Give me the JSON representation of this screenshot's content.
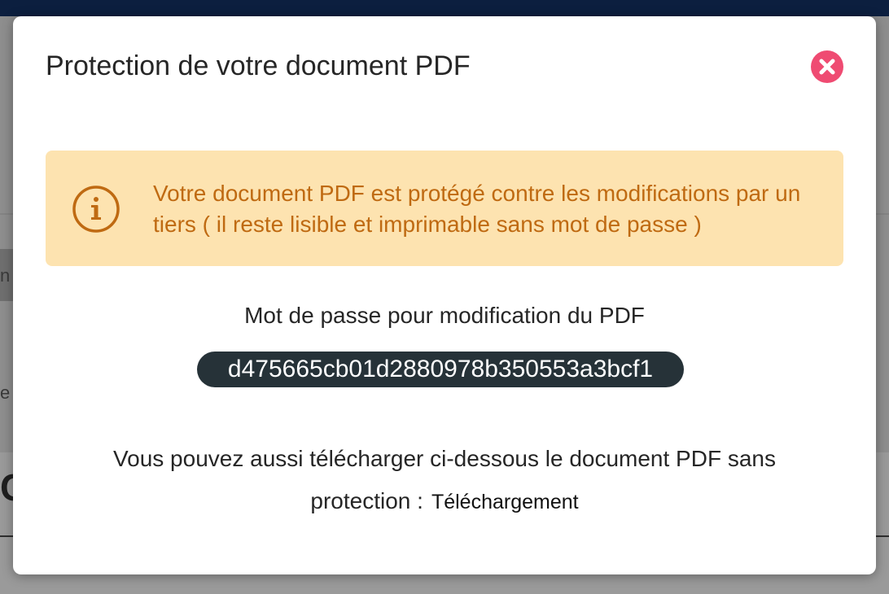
{
  "background": {
    "fragment_left_1": "n",
    "fragment_left_2": "e",
    "fragment_left_3": "C"
  },
  "modal": {
    "title": "Protection de votre document PDF",
    "close_icon": "close-circle-icon",
    "alert": {
      "icon": "info-circle-icon",
      "text": "Votre document PDF est protégé contre les modifications par un tiers ( il reste lisible et imprimable sans mot de passe )"
    },
    "password_label": "Mot de passe pour modification du PDF",
    "password_value": "d475665cb01d2880978b350553a3bcf1",
    "download_text": "Vous pouvez aussi télécharger ci-dessous le document PDF sans protection :",
    "download_link": "Téléchargement"
  },
  "colors": {
    "close_button": "#ef4b72",
    "alert_bg": "#fde3b0",
    "alert_text": "#bf6a12",
    "badge_bg": "#263238",
    "topbar": "#0c1f3f"
  }
}
